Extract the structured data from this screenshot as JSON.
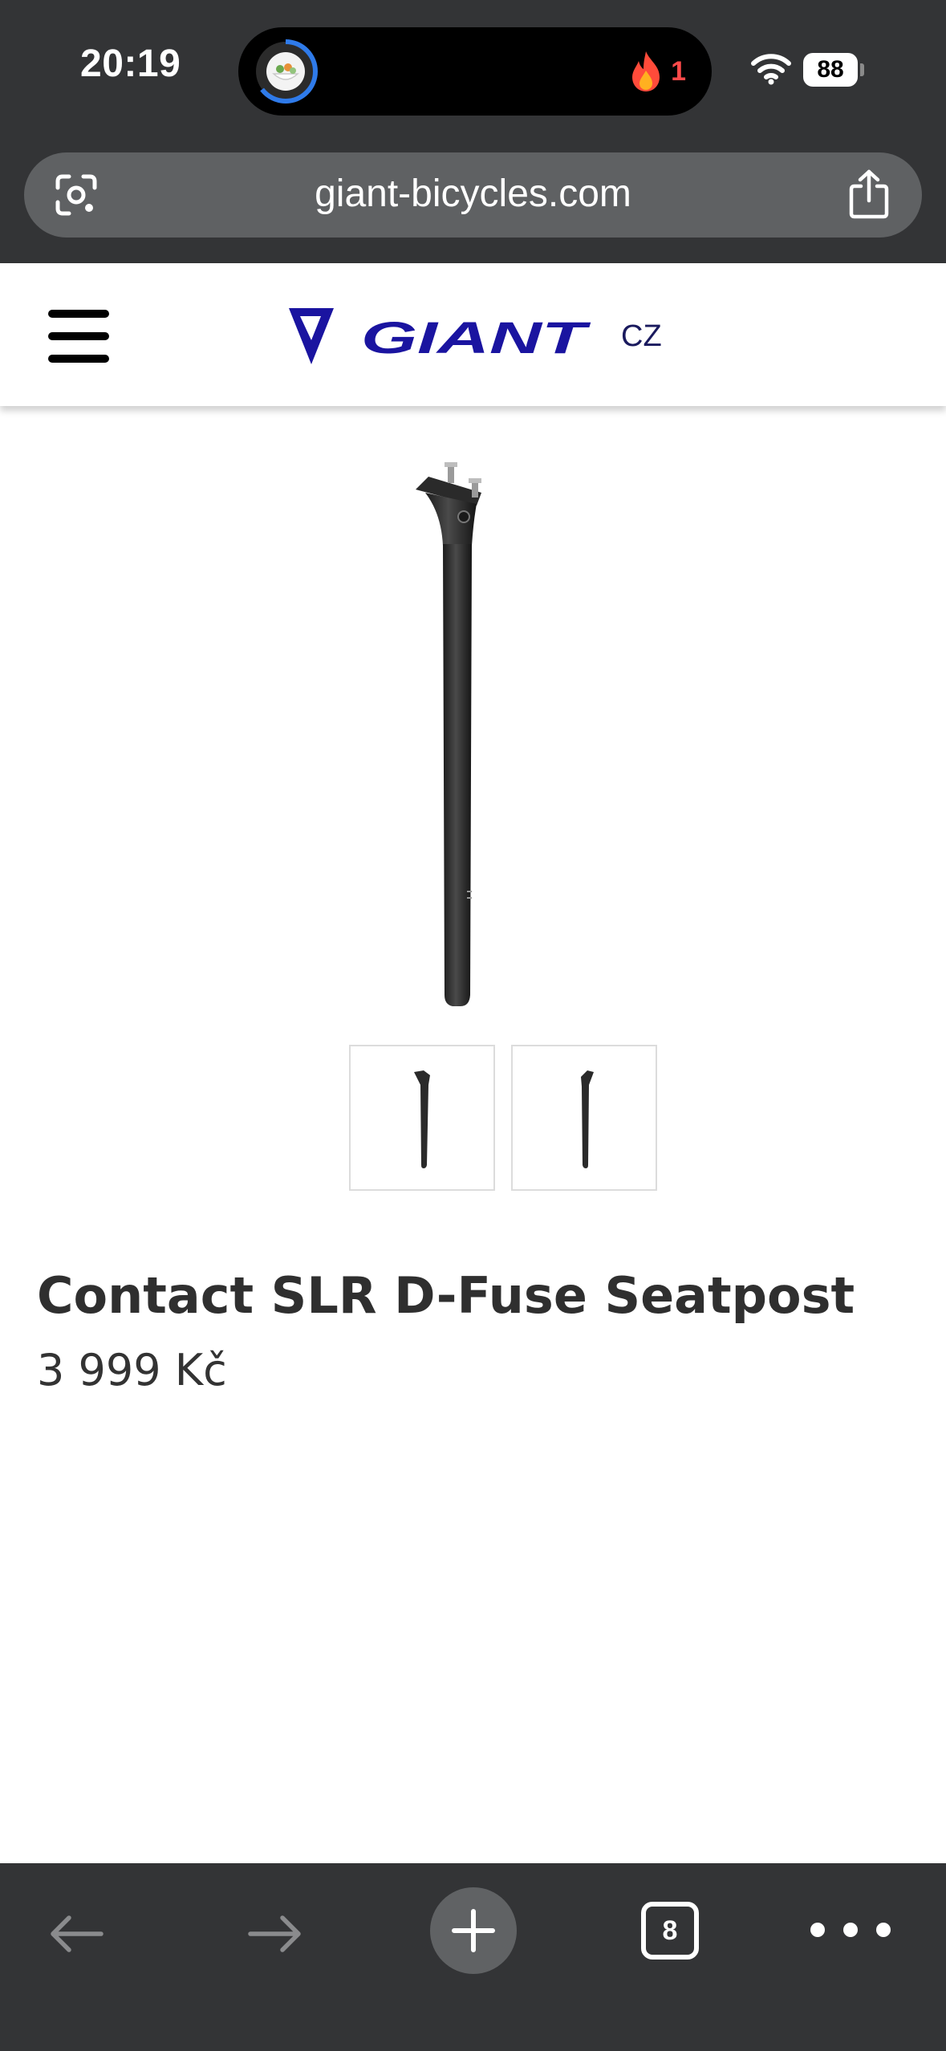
{
  "status_bar": {
    "time": "20:19",
    "streak_count": "1",
    "battery_level": "88"
  },
  "browser": {
    "url": "giant-bicycles.com",
    "open_tabs": "8",
    "back_enabled": false,
    "forward_enabled": false
  },
  "site": {
    "brand": "GIANT",
    "country": "CZ",
    "brand_color": "#1a14a0"
  },
  "product": {
    "name": "Contact SLR D-Fuse Seatpost",
    "price": "3 999 Kč",
    "thumbnail_count": 2
  },
  "icons": {
    "lens": "google-lens-icon",
    "share": "share-icon",
    "menu": "hamburger-menu-icon",
    "back": "arrow-left-icon",
    "forward": "arrow-right-icon",
    "new_tab": "plus-icon",
    "more": "more-dots-icon"
  }
}
